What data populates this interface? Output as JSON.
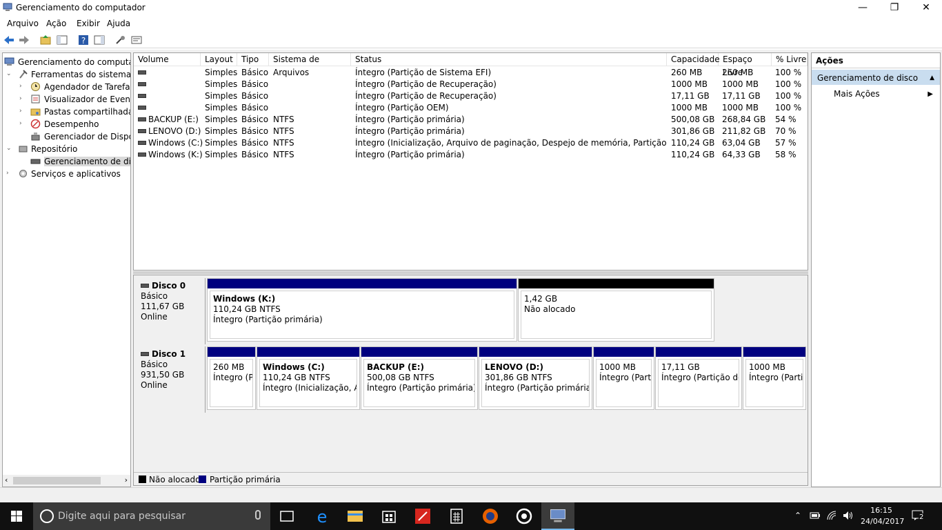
{
  "window": {
    "title": "Gerenciamento do computador",
    "minimize_glyph": "—",
    "restore_glyph": "❐",
    "close_glyph": "✕"
  },
  "menu": [
    "Arquivo",
    "Ação",
    "Exibir",
    "Ajuda"
  ],
  "tree": {
    "root": "Gerenciamento do computador",
    "ferramentas": "Ferramentas do sistema",
    "agendador": "Agendador de Tarefas",
    "visualizador": "Visualizador de Eventos",
    "pastas": "Pastas compartilhadas",
    "desempenho": "Desempenho",
    "gerenciador": "Gerenciador de Disposit",
    "repositorio": "Repositório",
    "disco": "Gerenciamento de disco",
    "servicos": "Serviços e aplicativos"
  },
  "volumes": {
    "columns": [
      "Volume",
      "Layout",
      "Tipo",
      "Sistema de Arquivos",
      "Status",
      "Capacidade",
      "Espaço Livre",
      "% Livre"
    ],
    "rows": [
      {
        "volume": "",
        "layout": "Simples",
        "tipo": "Básico",
        "fs": "",
        "status": "Íntegro (Partição de Sistema EFI)",
        "cap": "260 MB",
        "livre": "260 MB",
        "pct": "100 %"
      },
      {
        "volume": "",
        "layout": "Simples",
        "tipo": "Básico",
        "fs": "",
        "status": "Íntegro (Partição de Recuperação)",
        "cap": "1000 MB",
        "livre": "1000 MB",
        "pct": "100 %"
      },
      {
        "volume": "",
        "layout": "Simples",
        "tipo": "Básico",
        "fs": "",
        "status": "Íntegro (Partição de Recuperação)",
        "cap": "17,11 GB",
        "livre": "17,11 GB",
        "pct": "100 %"
      },
      {
        "volume": "",
        "layout": "Simples",
        "tipo": "Básico",
        "fs": "",
        "status": "Íntegro (Partição OEM)",
        "cap": "1000 MB",
        "livre": "1000 MB",
        "pct": "100 %"
      },
      {
        "volume": "BACKUP (E:)",
        "layout": "Simples",
        "tipo": "Básico",
        "fs": "NTFS",
        "status": "Íntegro (Partição primária)",
        "cap": "500,08 GB",
        "livre": "268,84 GB",
        "pct": "54 %"
      },
      {
        "volume": "LENOVO (D:)",
        "layout": "Simples",
        "tipo": "Básico",
        "fs": "NTFS",
        "status": "Íntegro (Partição primária)",
        "cap": "301,86 GB",
        "livre": "211,82 GB",
        "pct": "70 %"
      },
      {
        "volume": "Windows (C:)",
        "layout": "Simples",
        "tipo": "Básico",
        "fs": "NTFS",
        "status": "Íntegro (Inicialização, Arquivo de paginação, Despejo de memória, Partição primária)",
        "cap": "110,24 GB",
        "livre": "63,04 GB",
        "pct": "57 %"
      },
      {
        "volume": "Windows (K:)",
        "layout": "Simples",
        "tipo": "Básico",
        "fs": "NTFS",
        "status": "Íntegro (Partição primária)",
        "cap": "110,24 GB",
        "livre": "64,33 GB",
        "pct": "58 %"
      }
    ]
  },
  "disks": [
    {
      "name": "Disco 0",
      "type": "Básico",
      "size": "111,67 GB",
      "state": "Online",
      "parts": [
        {
          "name": "Windows  (K:)",
          "size": "110,24 GB NTFS",
          "status": "Íntegro (Partição primária)"
        },
        {
          "name": "",
          "size": "1,42 GB",
          "status": "Não alocado"
        }
      ]
    },
    {
      "name": "Disco 1",
      "type": "Básico",
      "size": "931,50 GB",
      "state": "Online",
      "parts": [
        {
          "name": "",
          "size": "260 MB",
          "status": "Íntegro (Pa"
        },
        {
          "name": "Windows  (C:)",
          "size": "110,24 GB NTFS",
          "status": "Íntegro (Inicialização, Arqu"
        },
        {
          "name": "BACKUP  (E:)",
          "size": "500,08 GB NTFS",
          "status": "Íntegro (Partição primária)"
        },
        {
          "name": "LENOVO  (D:)",
          "size": "301,86 GB NTFS",
          "status": "Íntegro (Partição primária)"
        },
        {
          "name": "",
          "size": "1000 MB",
          "status": "Íntegro (Partiç"
        },
        {
          "name": "",
          "size": "17,11 GB",
          "status": "Íntegro (Partição de F"
        },
        {
          "name": "",
          "size": "1000 MB",
          "status": "Íntegro (Partiçã"
        }
      ]
    }
  ],
  "legend": {
    "unallocated": "Não alocado",
    "primary": "Partição primária"
  },
  "actions": {
    "header": "Ações",
    "section": "Gerenciamento de disco",
    "more": "Mais Ações"
  },
  "taskbar": {
    "search_placeholder": "Digite aqui para pesquisar",
    "time": "16:15",
    "date": "24/04/2017",
    "notifications": "2"
  },
  "colors": {
    "primary_partition": "#00007f",
    "unallocated": "#000000",
    "selection": "#c9ddef",
    "taskbar": "#101010"
  }
}
